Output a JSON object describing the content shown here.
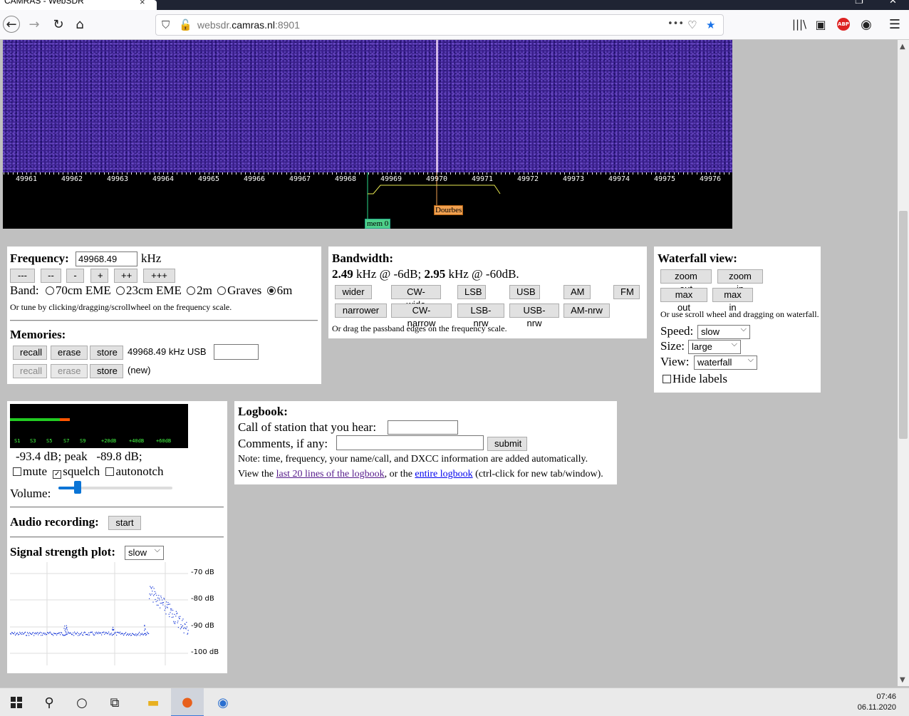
{
  "browser": {
    "tab_title": "CAMRAS - WebSDR",
    "tab_close": "×",
    "url_host": "websdr.",
    "url_domain": "camras.nl",
    "url_port": ":8901"
  },
  "scale": {
    "ticks": [
      "49961",
      "49962",
      "49963",
      "49964",
      "49965",
      "49966",
      "49967",
      "49968",
      "49969",
      "49970",
      "49971",
      "49972",
      "49973",
      "49974",
      "49975",
      "49976"
    ],
    "memory_tag": "mem 0",
    "station_tag": "Dourbes"
  },
  "frequency": {
    "label": "Frequency:",
    "value": "49968.49",
    "unit": "kHz",
    "step_buttons": [
      "---",
      "--",
      "-",
      "+",
      "++",
      "+++"
    ],
    "band_label": "Band:",
    "bands": [
      {
        "label": "70cm EME",
        "selected": false
      },
      {
        "label": "23cm EME",
        "selected": false
      },
      {
        "label": "2m",
        "selected": false
      },
      {
        "label": "Graves",
        "selected": false
      },
      {
        "label": "6m",
        "selected": true
      }
    ],
    "hint": "Or tune by clicking/dragging/scrollwheel on the frequency scale."
  },
  "memories": {
    "title": "Memories:",
    "row1": {
      "recall": "recall",
      "erase": "erase",
      "store": "store",
      "info": "49968.49 kHz USB",
      "name": ""
    },
    "row2": {
      "recall": "recall",
      "erase": "erase",
      "store": "store",
      "info": "(new)"
    }
  },
  "bandwidth": {
    "title": "Bandwidth:",
    "bw1": "2.49",
    "bw1_suffix": " kHz @ -6dB; ",
    "bw2": "2.95",
    "bw2_suffix": " kHz @ -60dB.",
    "row1": [
      "wider",
      "CW-wide",
      "LSB",
      "USB",
      "AM",
      "FM"
    ],
    "row2": [
      "narrower",
      "CW-narrow",
      "LSB-nrw",
      "USB-nrw",
      "AM-nrw"
    ],
    "hint": "Or drag the passband edges on the frequency scale."
  },
  "waterfall": {
    "title": "Waterfall view:",
    "zoom_out": "zoom out",
    "zoom_in": "zoom in",
    "max_out": "max out",
    "max_in": "max in",
    "hint": "Or use scroll wheel and dragging on waterfall.",
    "speed_label": "Speed:",
    "speed_value": "slow",
    "size_label": "Size:",
    "size_value": "large",
    "view_label": "View:",
    "view_value": "waterfall",
    "hide_labels": "Hide labels"
  },
  "audio": {
    "smeter_labels": [
      "S1",
      "S3",
      "S5",
      "S7",
      "S9",
      "+20dB",
      "+40dB",
      "+60dB"
    ],
    "level_text": "-93.4 dB; peak   -89.8 dB;",
    "mute": "mute",
    "mute_checked": false,
    "squelch": "squelch",
    "squelch_checked": true,
    "autonotch": "autonotch",
    "autonotch_checked": false,
    "volume_label": "Volume:",
    "volume_level": 0.17,
    "recording_label": "Audio recording:",
    "recording_button": "start",
    "plot_label": "Signal strength plot:",
    "plot_speed": "slow",
    "plot_db_labels": [
      "-70 dB",
      "-80 dB",
      "-90 dB",
      "-100 dB"
    ]
  },
  "logbook": {
    "title": "Logbook:",
    "call_label": "Call of station that you hear:",
    "comments_label": "Comments, if any:",
    "submit": "submit",
    "note": "Note: time, frequency, your name/call, and DXCC information are added automatically.",
    "view_prefix": "View the ",
    "link1": "last 20 lines of the logbook",
    "view_mid": ", or the ",
    "link2": "entire logbook",
    "view_suffix": " (ctrl-click for new tab/window)."
  },
  "taskbar": {
    "time": "07:46",
    "date": "06.11.2020"
  }
}
